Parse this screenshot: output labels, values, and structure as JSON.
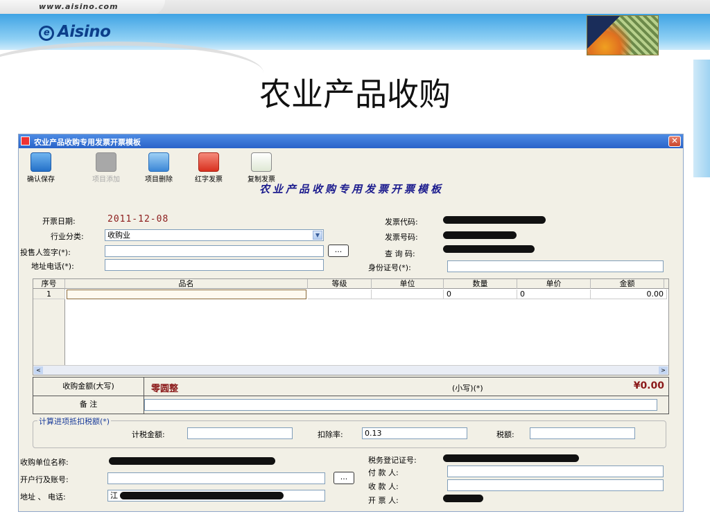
{
  "header": {
    "url": "www.aisino.com",
    "logo": "Aisino",
    "logo_mark": "e",
    "title": "农业产品收购"
  },
  "window": {
    "title": "农业产品收购专用发票开票模板",
    "close_label": "✕"
  },
  "toolbar": {
    "save": "确认保存",
    "add_item": "项目添加",
    "delete_item": "项目删除",
    "red_invoice": "红字发票",
    "copy_invoice": "复制发票"
  },
  "form": {
    "heading": "农业产品收购专用发票开票模板",
    "date_label": "开票日期:",
    "date_value": "2011-12-08",
    "industry_label": "行业分类:",
    "industry_value": "收购业",
    "seller_sign_label": "投售人签字(*):",
    "address_phone_label": "地址电话(*):",
    "invoice_code_label": "发票代码:",
    "invoice_no_label": "发票号码:",
    "query_code_label": "查 询 码:",
    "id_no_label": "身份证号(*):",
    "dots_label": "..."
  },
  "grid": {
    "columns": [
      "序号",
      "品名",
      "等级",
      "单位",
      "数量",
      "单价",
      "金额"
    ],
    "rows": [
      {
        "seq": "1",
        "name": "",
        "grade": "",
        "unit": "",
        "qty": "0",
        "price": "0",
        "amount": "0.00"
      }
    ],
    "scroll_left": "<",
    "scroll_right": ">"
  },
  "totals": {
    "amount_upper_label": "收购金额(大写)",
    "amount_upper_value": "零圆整",
    "amount_lower_label": "(小写)(*)",
    "amount_lower_value": "¥0.00",
    "remark_label": "备  注"
  },
  "tax": {
    "group_title": "计算进项抵扣税额(*)",
    "taxable_label": "计税金额:",
    "deduct_rate_label": "扣除率:",
    "deduct_rate_value": "0.13",
    "tax_label": "税额:"
  },
  "footer": {
    "buyer_name_label": "收购单位名称:",
    "bank_label": "开户行及账号:",
    "addr_phone_label": "地址 、 电话:",
    "addr_phone_prefix": "江",
    "tax_reg_label": "税务登记证号:",
    "payer_label": "付  款  人:",
    "payee_label": "收  款  人:",
    "issuer_label": "开  票  人:",
    "dots_label": "..."
  },
  "colors": {
    "accent_blue": "#2a63c9",
    "amount_red": "#8b1a1a",
    "form_heading": "#1c1c8e"
  }
}
